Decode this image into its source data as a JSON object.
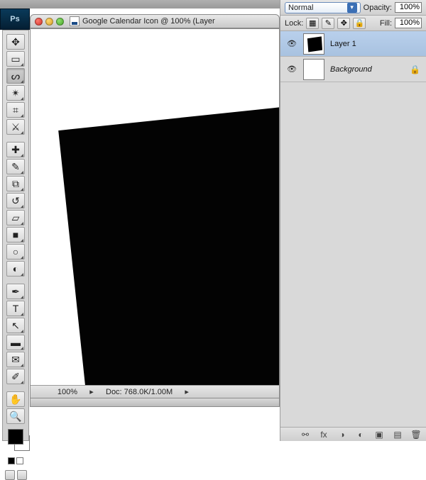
{
  "app": {
    "logo_text": "Ps"
  },
  "document": {
    "title": "Google Calendar Icon @ 100% (Layer"
  },
  "tools": [
    {
      "name": "move-tool"
    },
    {
      "name": "marquee-tool",
      "hasSub": true
    },
    {
      "name": "lasso-tool",
      "hasSub": true,
      "selected": true
    },
    {
      "name": "magic-wand-tool",
      "hasSub": true
    },
    {
      "name": "crop-tool",
      "hasSub": true
    },
    {
      "name": "slice-tool",
      "hasSub": true
    },
    {
      "sep": true
    },
    {
      "name": "healing-brush-tool",
      "hasSub": true
    },
    {
      "name": "brush-tool",
      "hasSub": true
    },
    {
      "name": "stamp-tool",
      "hasSub": true
    },
    {
      "name": "history-brush-tool",
      "hasSub": true
    },
    {
      "name": "eraser-tool",
      "hasSub": true
    },
    {
      "name": "gradient-tool",
      "hasSub": true
    },
    {
      "name": "blur-tool",
      "hasSub": true
    },
    {
      "name": "dodge-tool",
      "hasSub": true
    },
    {
      "sep": true
    },
    {
      "name": "pen-tool",
      "hasSub": true
    },
    {
      "name": "type-tool",
      "hasSub": true
    },
    {
      "name": "path-select-tool",
      "hasSub": true
    },
    {
      "name": "shape-tool",
      "hasSub": true
    },
    {
      "name": "notes-tool",
      "hasSub": true
    },
    {
      "name": "eyedropper-tool",
      "hasSub": true
    },
    {
      "sep": true
    },
    {
      "name": "hand-tool"
    },
    {
      "name": "zoom-tool"
    }
  ],
  "status": {
    "zoom": "100%",
    "doc_info": "Doc: 768.0K/1.00M"
  },
  "layers_panel": {
    "blend_mode": "Normal",
    "opacity_label": "Opacity:",
    "opacity_value": "100%",
    "fill_label": "Fill:",
    "fill_value": "100%",
    "lock_label": "Lock:",
    "layers": [
      {
        "name": "Layer 1",
        "selected": true,
        "thumb": "l1"
      },
      {
        "name": "Background",
        "locked": true,
        "thumb": "bg",
        "italic": true
      }
    ],
    "footer_icons": [
      "link-icon",
      "fx-icon",
      "mask-icon",
      "adjust-icon",
      "group-icon",
      "new-icon",
      "trash-icon"
    ]
  },
  "colors": {
    "fg": "#000000",
    "bg": "#ffffff"
  },
  "glyphs": {
    "move-tool": "✥",
    "marquee-tool": "▭",
    "lasso-tool": "ᔕ",
    "magic-wand-tool": "✴",
    "crop-tool": "⌗",
    "slice-tool": "⚔",
    "healing-brush-tool": "✚",
    "brush-tool": "✎",
    "stamp-tool": "⧉",
    "history-brush-tool": "↺",
    "eraser-tool": "▱",
    "gradient-tool": "■",
    "blur-tool": "○",
    "dodge-tool": "◐",
    "pen-tool": "✒",
    "type-tool": "T",
    "path-select-tool": "↖",
    "shape-tool": "▬",
    "notes-tool": "✉",
    "eyedropper-tool": "✐",
    "hand-tool": "✋",
    "zoom-tool": "🔍",
    "eye": "👁",
    "lock": "🔒",
    "link-icon": "⚯",
    "fx-icon": "fx",
    "mask-icon": "◑",
    "adjust-icon": "◐",
    "group-icon": "▣",
    "new-icon": "▤",
    "trash-icon": "🗑"
  }
}
